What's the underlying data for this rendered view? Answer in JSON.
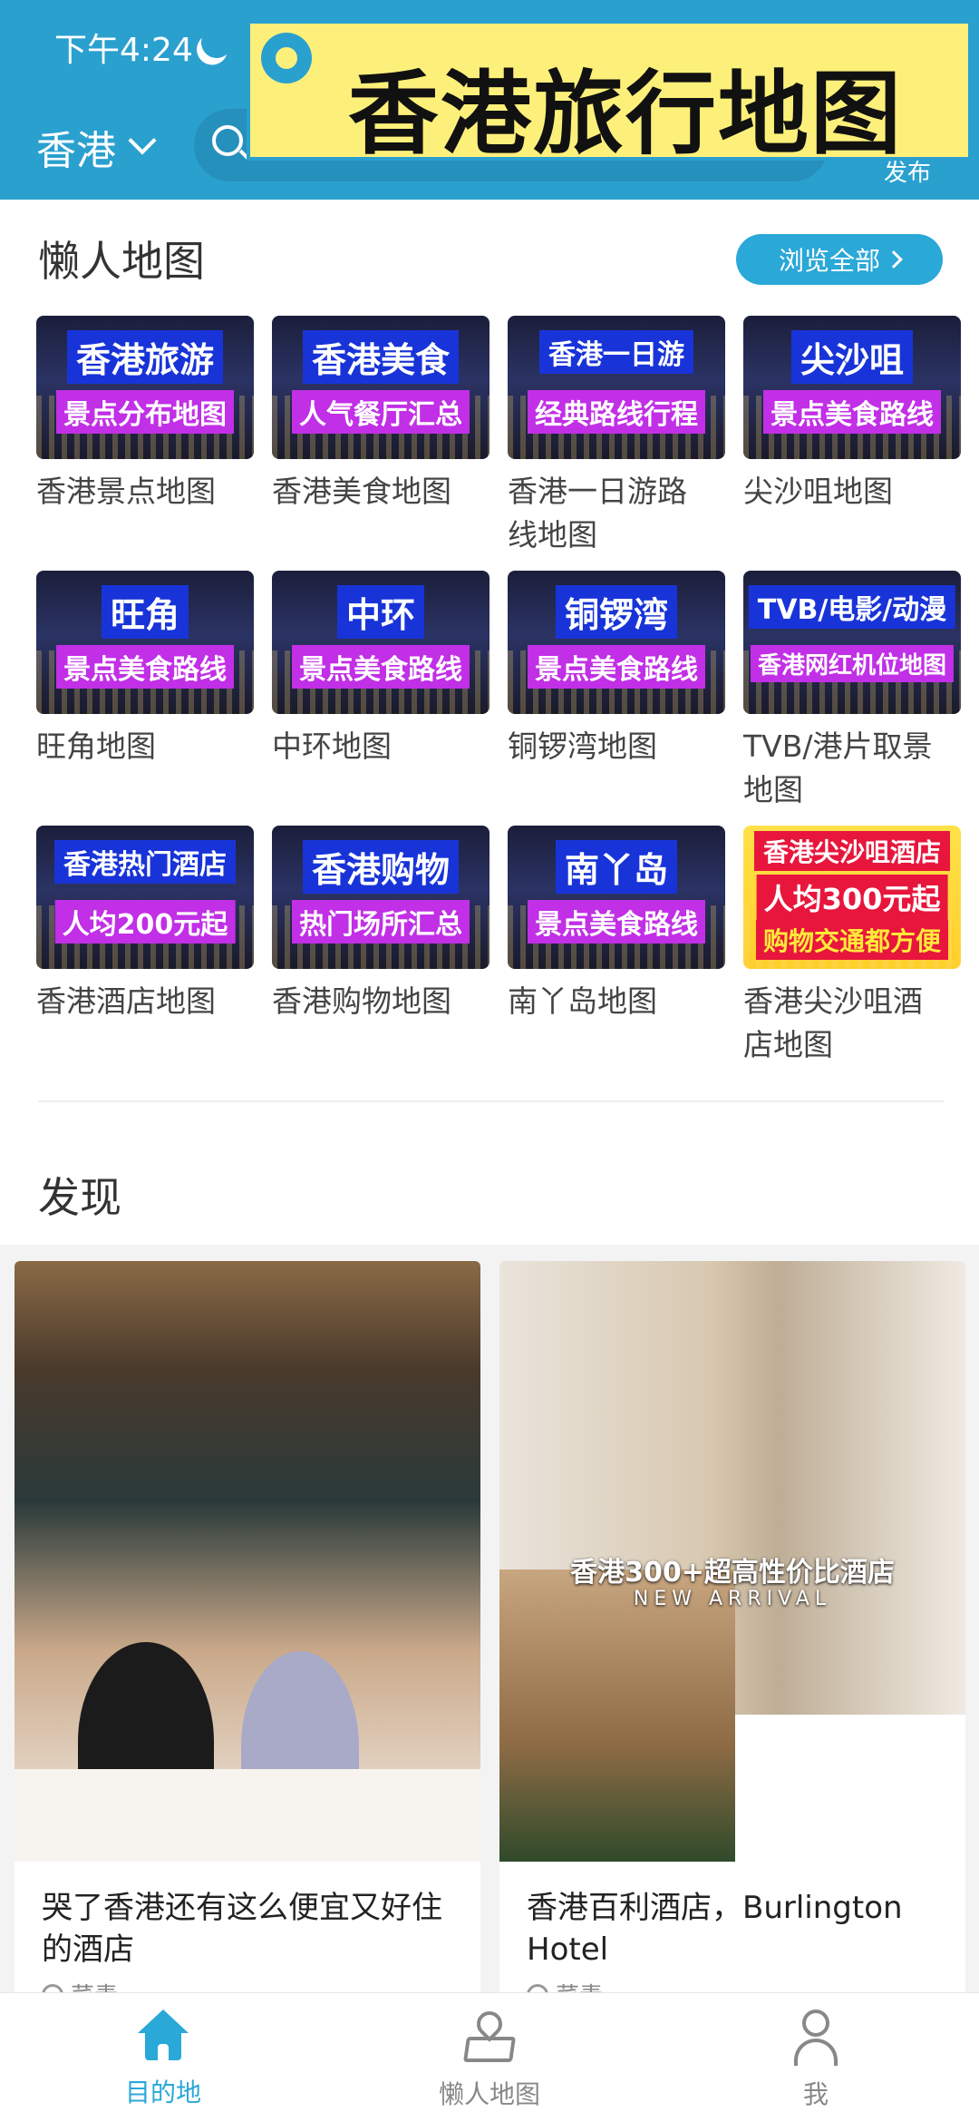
{
  "status_bar": {
    "time": "下午4:24"
  },
  "header": {
    "city": "香港",
    "publish_label": "发布",
    "banner_title": "香港旅行地图"
  },
  "lazy_maps": {
    "title": "懒人地图",
    "browse_all": "浏览全部",
    "items": [
      {
        "thumb_line1": "香港旅游",
        "thumb_line2": "景点分布地图",
        "label": "香港景点地图"
      },
      {
        "thumb_line1": "香港美食",
        "thumb_line2": "人气餐厅汇总",
        "label": "香港美食地图"
      },
      {
        "thumb_line1": "香港一日游",
        "thumb_line2": "经典路线行程",
        "label": "香港一日游路线地图"
      },
      {
        "thumb_line1": "尖沙咀",
        "thumb_line2": "景点美食路线",
        "label": "尖沙咀地图"
      },
      {
        "thumb_line1": "旺角",
        "thumb_line2": "景点美食路线",
        "label": "旺角地图"
      },
      {
        "thumb_line1": "中环",
        "thumb_line2": "景点美食路线",
        "label": "中环地图"
      },
      {
        "thumb_line1": "铜锣湾",
        "thumb_line2": "景点美食路线",
        "label": "铜锣湾地图"
      },
      {
        "thumb_line1": "TVB/电影/动漫",
        "thumb_line2": "香港网红机位地图",
        "label": "TVB/港片取景地图"
      },
      {
        "thumb_line1": "香港热门酒店",
        "thumb_line2": "人均200元起",
        "label": "香港酒店地图"
      },
      {
        "thumb_line1": "香港购物",
        "thumb_line2": "热门场所汇总",
        "label": "香港购物地图"
      },
      {
        "thumb_line1": "南丫岛",
        "thumb_line2": "景点美食路线",
        "label": "南丫岛地图"
      },
      {
        "thumb_line1": "香港尖沙咀酒店",
        "thumb_line2": "人均300元起",
        "thumb_line3": "购物交通都方便",
        "label": "香港尖沙咀酒店地图"
      }
    ]
  },
  "discover": {
    "title": "发现",
    "cards": [
      {
        "title": "哭了香港还有这么便宜又好住的酒店",
        "author": "菜青"
      },
      {
        "title": "香港百利酒店，Burlington Hotel",
        "author": "菜青",
        "overlay_line1": "香港300+超高性价比酒店",
        "overlay_line2": "NEW ARRIVAL"
      }
    ]
  },
  "bottom_nav": {
    "items": [
      {
        "label": "目的地",
        "icon": "home-icon",
        "active": true
      },
      {
        "label": "懒人地图",
        "icon": "map-pin-icon",
        "active": false
      },
      {
        "label": "我",
        "icon": "user-icon",
        "active": false
      }
    ]
  },
  "colors": {
    "header_bg": "#2aa0cf",
    "accent": "#2aa8d8",
    "banner_bg": "#fdf07a"
  }
}
